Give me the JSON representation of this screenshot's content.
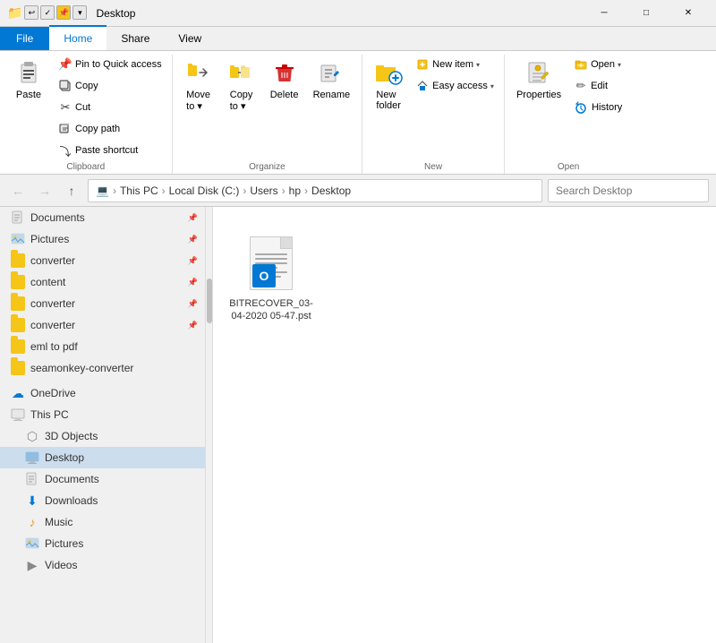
{
  "titlebar": {
    "title": "Desktop",
    "controls": [
      "─",
      "□",
      "✕"
    ]
  },
  "ribbon_tabs": {
    "tabs": [
      "File",
      "Home",
      "Share",
      "View"
    ],
    "active": "Home"
  },
  "ribbon": {
    "clipboard": {
      "label": "Clipboard",
      "pin_to_quick": "Pin to Quick\naccess",
      "copy": "Copy",
      "paste": "Paste",
      "cut": "Cut",
      "copy_path": "Copy path",
      "paste_shortcut": "Paste shortcut"
    },
    "organize": {
      "label": "Organize",
      "move_to": "Move\nto",
      "copy_to": "Copy\nto",
      "delete": "Delete",
      "rename": "Rename"
    },
    "new": {
      "label": "New",
      "new_folder": "New\nfolder",
      "new_item": "New item",
      "easy_access": "Easy access"
    },
    "open": {
      "label": "Open",
      "open_btn": "Open",
      "properties": "Properties",
      "edit": "Edit",
      "history": "History"
    }
  },
  "address_bar": {
    "back_disabled": true,
    "forward_disabled": true,
    "path_parts": [
      "This PC",
      "Local Disk (C:)",
      "Users",
      "hp",
      "Desktop"
    ],
    "search_placeholder": "Search Desktop"
  },
  "sidebar": {
    "quick_access": [
      {
        "label": "Documents",
        "icon": "docs",
        "pinned": true
      },
      {
        "label": "Pictures",
        "icon": "pics",
        "pinned": true
      },
      {
        "label": "converter",
        "icon": "folder",
        "pinned": true
      },
      {
        "label": "content",
        "icon": "folder",
        "pinned": true
      },
      {
        "label": "converter",
        "icon": "folder",
        "pinned": true
      },
      {
        "label": "converter",
        "icon": "folder",
        "pinned": true
      },
      {
        "label": "eml to pdf",
        "icon": "folder",
        "pinned": false
      },
      {
        "label": "seamonkey-converter",
        "icon": "folder",
        "pinned": false
      }
    ],
    "onedrive": {
      "label": "OneDrive",
      "icon": "onedrive"
    },
    "this_pc": {
      "label": "This PC",
      "icon": "thispc",
      "children": [
        {
          "label": "3D Objects",
          "icon": "objects"
        },
        {
          "label": "Desktop",
          "icon": "desktop"
        },
        {
          "label": "Documents",
          "icon": "docs"
        },
        {
          "label": "Downloads",
          "icon": "dl"
        },
        {
          "label": "Music",
          "icon": "music"
        },
        {
          "label": "Pictures",
          "icon": "pics"
        },
        {
          "label": "Videos",
          "icon": "vid"
        }
      ]
    }
  },
  "content": {
    "files": [
      {
        "name": "BITRECOVER_03-\n04-2020\n05-47.pst",
        "type": "pst",
        "selected": false
      }
    ]
  }
}
